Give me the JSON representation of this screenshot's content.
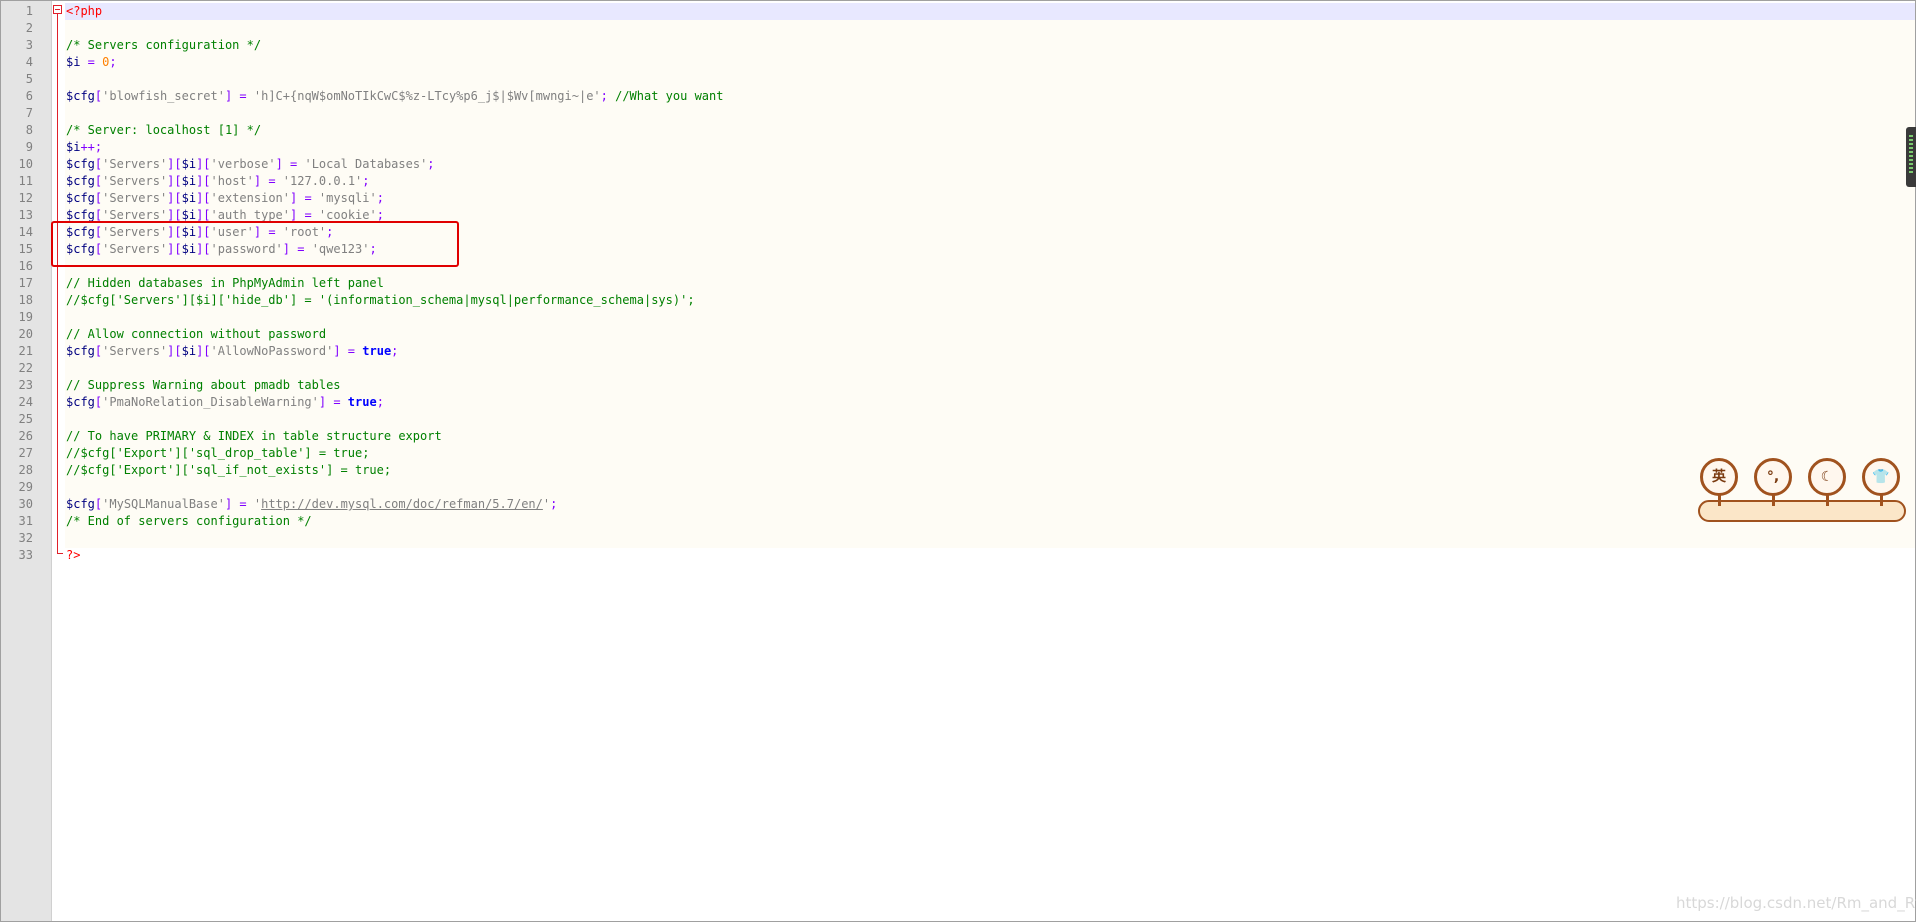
{
  "editor": {
    "line_numbers": [
      "1",
      "2",
      "3",
      "4",
      "5",
      "6",
      "7",
      "8",
      "9",
      "10",
      "11",
      "12",
      "13",
      "14",
      "15",
      "16",
      "17",
      "18",
      "19",
      "20",
      "21",
      "22",
      "23",
      "24",
      "25",
      "26",
      "27",
      "28",
      "29",
      "30",
      "31",
      "32",
      "33"
    ],
    "lines": [
      [
        {
          "t": "<?php",
          "c": "tag"
        }
      ],
      [],
      [
        {
          "t": "/* Servers configuration */",
          "c": "cmt"
        }
      ],
      [
        {
          "t": "$i",
          "c": "var"
        },
        {
          "t": " = ",
          "c": "punct"
        },
        {
          "t": "0",
          "c": "num"
        },
        {
          "t": ";",
          "c": "punct"
        }
      ],
      [],
      [
        {
          "t": "$cfg",
          "c": "var"
        },
        {
          "t": "[",
          "c": "punct"
        },
        {
          "t": "'blowfish_secret'",
          "c": "str"
        },
        {
          "t": "] = ",
          "c": "punct"
        },
        {
          "t": "'h]C+{nqW$omNoTIkCwC$%z-LTcy%p6_j$|$Wv[mwngi~|e'",
          "c": "str"
        },
        {
          "t": "; ",
          "c": "punct"
        },
        {
          "t": "//What you want",
          "c": "cmt"
        }
      ],
      [],
      [
        {
          "t": "/* Server: localhost [1] */",
          "c": "cmt"
        }
      ],
      [
        {
          "t": "$i",
          "c": "var"
        },
        {
          "t": "++;",
          "c": "punct"
        }
      ],
      [
        {
          "t": "$cfg",
          "c": "var"
        },
        {
          "t": "[",
          "c": "punct"
        },
        {
          "t": "'Servers'",
          "c": "str"
        },
        {
          "t": "][",
          "c": "punct"
        },
        {
          "t": "$i",
          "c": "var"
        },
        {
          "t": "][",
          "c": "punct"
        },
        {
          "t": "'verbose'",
          "c": "str"
        },
        {
          "t": "] = ",
          "c": "punct"
        },
        {
          "t": "'Local Databases'",
          "c": "str"
        },
        {
          "t": ";",
          "c": "punct"
        }
      ],
      [
        {
          "t": "$cfg",
          "c": "var"
        },
        {
          "t": "[",
          "c": "punct"
        },
        {
          "t": "'Servers'",
          "c": "str"
        },
        {
          "t": "][",
          "c": "punct"
        },
        {
          "t": "$i",
          "c": "var"
        },
        {
          "t": "][",
          "c": "punct"
        },
        {
          "t": "'host'",
          "c": "str"
        },
        {
          "t": "] = ",
          "c": "punct"
        },
        {
          "t": "'127.0.0.1'",
          "c": "str"
        },
        {
          "t": ";",
          "c": "punct"
        }
      ],
      [
        {
          "t": "$cfg",
          "c": "var"
        },
        {
          "t": "[",
          "c": "punct"
        },
        {
          "t": "'Servers'",
          "c": "str"
        },
        {
          "t": "][",
          "c": "punct"
        },
        {
          "t": "$i",
          "c": "var"
        },
        {
          "t": "][",
          "c": "punct"
        },
        {
          "t": "'extension'",
          "c": "str"
        },
        {
          "t": "] = ",
          "c": "punct"
        },
        {
          "t": "'mysqli'",
          "c": "str"
        },
        {
          "t": ";",
          "c": "punct"
        }
      ],
      [
        {
          "t": "$cfg",
          "c": "var"
        },
        {
          "t": "[",
          "c": "punct"
        },
        {
          "t": "'Servers'",
          "c": "str"
        },
        {
          "t": "][",
          "c": "punct"
        },
        {
          "t": "$i",
          "c": "var"
        },
        {
          "t": "][",
          "c": "punct"
        },
        {
          "t": "'auth_type'",
          "c": "str"
        },
        {
          "t": "] = ",
          "c": "punct"
        },
        {
          "t": "'cookie'",
          "c": "str"
        },
        {
          "t": ";",
          "c": "punct"
        }
      ],
      [
        {
          "t": "$cfg",
          "c": "var"
        },
        {
          "t": "[",
          "c": "punct"
        },
        {
          "t": "'Servers'",
          "c": "str"
        },
        {
          "t": "][",
          "c": "punct"
        },
        {
          "t": "$i",
          "c": "var"
        },
        {
          "t": "][",
          "c": "punct"
        },
        {
          "t": "'user'",
          "c": "str"
        },
        {
          "t": "] = ",
          "c": "punct"
        },
        {
          "t": "'root'",
          "c": "str"
        },
        {
          "t": ";",
          "c": "punct"
        }
      ],
      [
        {
          "t": "$cfg",
          "c": "var"
        },
        {
          "t": "[",
          "c": "punct"
        },
        {
          "t": "'Servers'",
          "c": "str"
        },
        {
          "t": "][",
          "c": "punct"
        },
        {
          "t": "$i",
          "c": "var"
        },
        {
          "t": "][",
          "c": "punct"
        },
        {
          "t": "'password'",
          "c": "str"
        },
        {
          "t": "] = ",
          "c": "punct"
        },
        {
          "t": "'qwe123'",
          "c": "str"
        },
        {
          "t": ";",
          "c": "punct"
        }
      ],
      [],
      [
        {
          "t": "// Hidden databases in PhpMyAdmin left panel",
          "c": "cmt"
        }
      ],
      [
        {
          "t": "//$cfg['Servers'][$i]['hide_db'] = '(information_schema|mysql|performance_schema|sys)';",
          "c": "cmt"
        }
      ],
      [],
      [
        {
          "t": "// Allow connection without password",
          "c": "cmt"
        }
      ],
      [
        {
          "t": "$cfg",
          "c": "var"
        },
        {
          "t": "[",
          "c": "punct"
        },
        {
          "t": "'Servers'",
          "c": "str"
        },
        {
          "t": "][",
          "c": "punct"
        },
        {
          "t": "$i",
          "c": "var"
        },
        {
          "t": "][",
          "c": "punct"
        },
        {
          "t": "'AllowNoPassword'",
          "c": "str"
        },
        {
          "t": "] = ",
          "c": "punct"
        },
        {
          "t": "true",
          "c": "kw"
        },
        {
          "t": ";",
          "c": "punct"
        }
      ],
      [],
      [
        {
          "t": "// Suppress Warning about pmadb tables",
          "c": "cmt"
        }
      ],
      [
        {
          "t": "$cfg",
          "c": "var"
        },
        {
          "t": "[",
          "c": "punct"
        },
        {
          "t": "'PmaNoRelation_DisableWarning'",
          "c": "str"
        },
        {
          "t": "] = ",
          "c": "punct"
        },
        {
          "t": "true",
          "c": "kw"
        },
        {
          "t": ";",
          "c": "punct"
        }
      ],
      [],
      [
        {
          "t": "// To have PRIMARY & INDEX in table structure export",
          "c": "cmt"
        }
      ],
      [
        {
          "t": "//$cfg['Export']['sql_drop_table'] = true;",
          "c": "cmt"
        }
      ],
      [
        {
          "t": "//$cfg['Export']['sql_if_not_exists'] = true;",
          "c": "cmt"
        }
      ],
      [],
      [
        {
          "t": "$cfg",
          "c": "var"
        },
        {
          "t": "[",
          "c": "punct"
        },
        {
          "t": "'MySQLManualBase'",
          "c": "str"
        },
        {
          "t": "] = ",
          "c": "punct"
        },
        {
          "t": "'",
          "c": "str"
        },
        {
          "t": "http://dev.mysql.com/doc/refman/5.7/en/",
          "c": "url"
        },
        {
          "t": "'",
          "c": "str"
        },
        {
          "t": ";",
          "c": "punct"
        }
      ],
      [
        {
          "t": "/* End of servers configuration */",
          "c": "cmt"
        }
      ],
      [],
      [
        {
          "t": "?>",
          "c": "tag"
        }
      ]
    ]
  },
  "ime_toolbar": {
    "buttons": [
      {
        "label": "英",
        "icon": "english-mode-icon"
      },
      {
        "label": "°,",
        "icon": "punctuation-icon"
      },
      {
        "label": "☾",
        "icon": "half-width-moon-icon"
      },
      {
        "label": "👕",
        "icon": "skin-shirt-icon"
      }
    ]
  },
  "watermark": "https://blog.csdn.net/Rm_and_Rf",
  "colors": {
    "comment": "#008000",
    "string": "#808080",
    "variable": "#000080",
    "operator": "#8000ff",
    "number": "#ff8000",
    "php_tag": "#ff0000",
    "keyword": "#0000ff",
    "highlight_box": "#e00000"
  }
}
